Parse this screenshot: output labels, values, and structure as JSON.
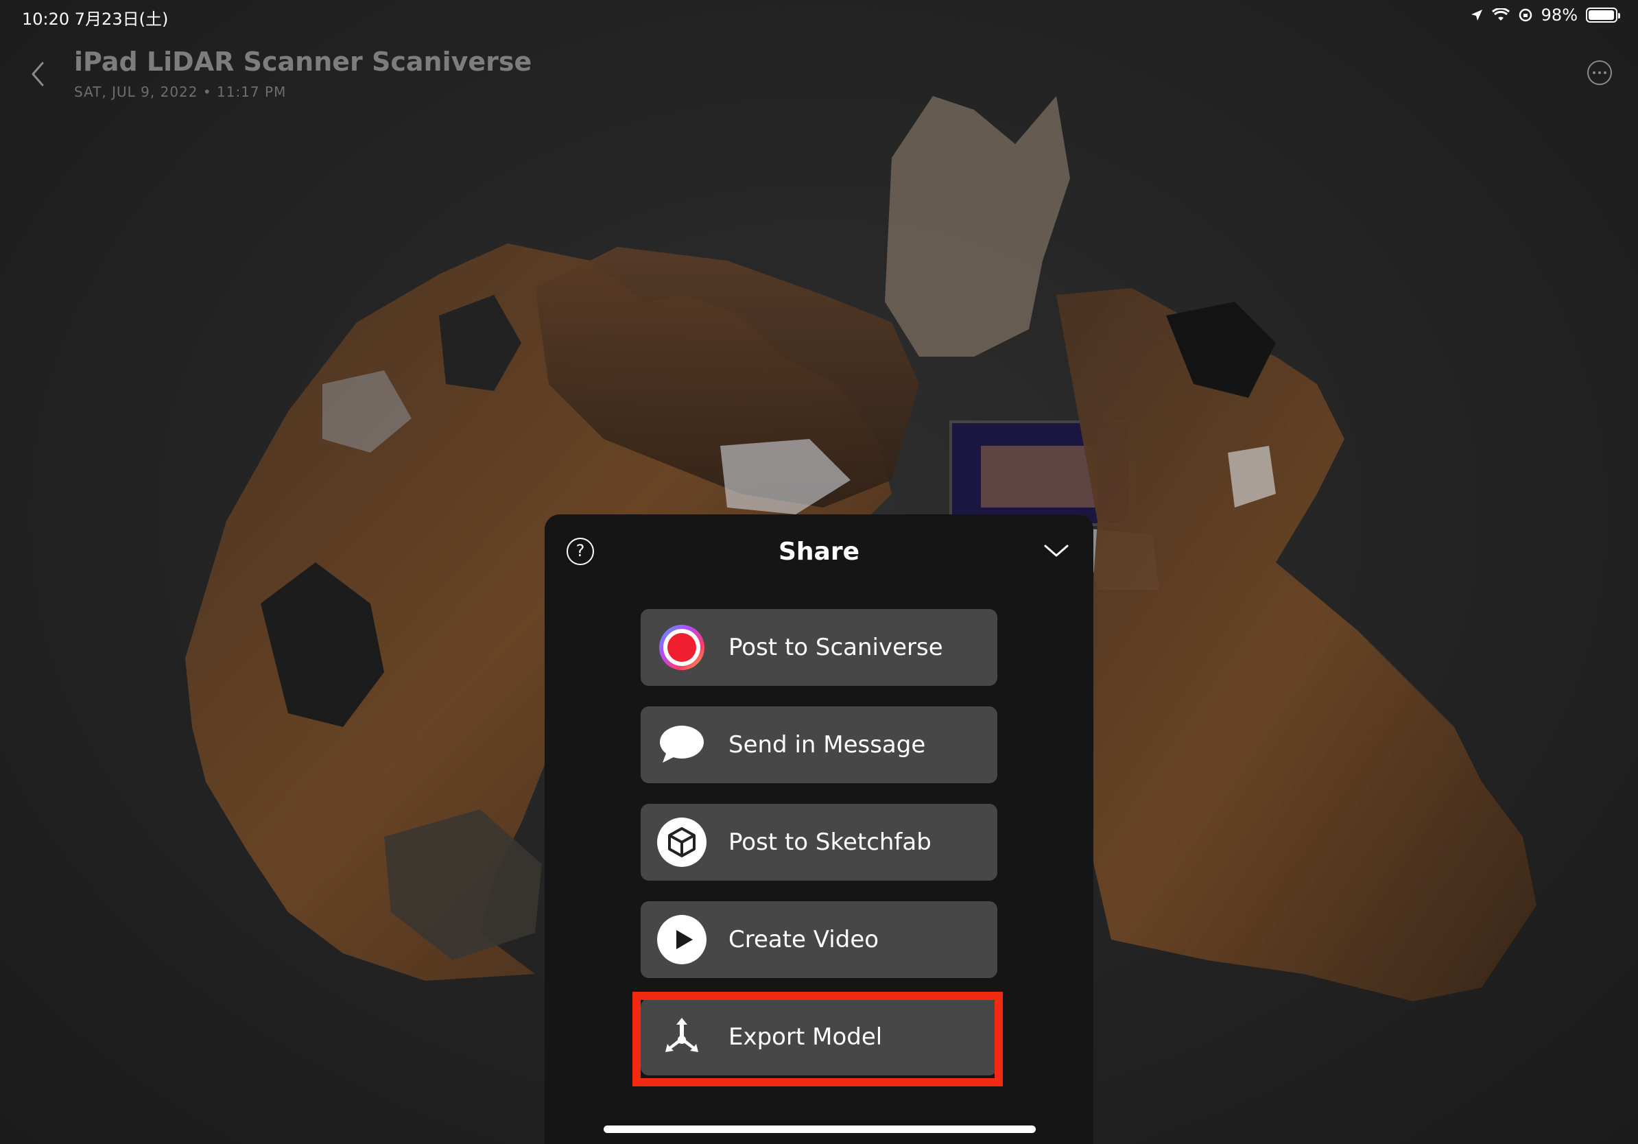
{
  "status_bar": {
    "time_date": "10:20   7月23日(土)",
    "battery_percent": "98%",
    "battery_level": 0.98,
    "icons": [
      "location-icon",
      "wifi-icon",
      "orientation-lock-icon",
      "battery-icon"
    ]
  },
  "header": {
    "title": "iPad LiDAR Scanner Scaniverse",
    "subtitle": "SAT, JUL 9, 2022  •  11:17 PM",
    "back_icon": "chevron-left-icon",
    "more_icon": "ellipsis-circle-icon"
  },
  "share_sheet": {
    "title": "Share",
    "help_label": "?",
    "actions": [
      {
        "label": "Post to Scaniverse",
        "icon": "scaniverse-logo-icon"
      },
      {
        "label": "Send in Message",
        "icon": "message-bubble-icon"
      },
      {
        "label": "Post to Sketchfab",
        "icon": "sketchfab-cube-icon"
      },
      {
        "label": "Create Video",
        "icon": "play-icon"
      },
      {
        "label": "Export Model",
        "icon": "export-axes-icon"
      }
    ],
    "highlighted_action": "Export Model"
  },
  "colors": {
    "panel_bg": "#151515",
    "button_bg": "#474747",
    "highlight_border": "#f12b12",
    "background": "#242424"
  }
}
